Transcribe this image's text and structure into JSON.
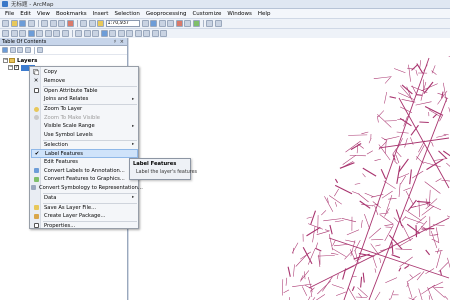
{
  "window": {
    "title": "无标题 - ArcMap"
  },
  "menubar": {
    "items": [
      "File",
      "Edit",
      "View",
      "Bookmarks",
      "Insert",
      "Selection",
      "Geoprocessing",
      "Customize",
      "Windows",
      "Help"
    ]
  },
  "toolbar": {
    "scale_value": "1:70,937"
  },
  "toc": {
    "title": "Table Of Contents",
    "controls": "♯ ×",
    "root_label": "Layers",
    "layer_label": ""
  },
  "context_menu": {
    "items": [
      {
        "label": "Copy",
        "icon": "copy-icon"
      },
      {
        "label": "Remove",
        "icon": "remove-icon"
      },
      {
        "label": "Open Attribute Table",
        "icon": "table-icon"
      },
      {
        "label": "Joins and Relates",
        "submenu": true
      },
      {
        "label": "Zoom To Layer",
        "icon": "zoom-layer-icon"
      },
      {
        "label": "Zoom To Make Visible",
        "disabled": true
      },
      {
        "label": "Visible Scale Range",
        "submenu": true
      },
      {
        "label": "Use Symbol Levels"
      },
      {
        "label": "Selection",
        "submenu": true
      },
      {
        "label": "Label Features",
        "checked": true,
        "highlighted": true
      },
      {
        "label": "Edit Features",
        "submenu": true
      },
      {
        "label": "Convert Labels to Annotation...",
        "icon": "convert-labels-icon"
      },
      {
        "label": "Convert Features to Graphics...",
        "icon": "convert-features-icon"
      },
      {
        "label": "Convert Symbology to Representation...",
        "icon": "convert-symbology-icon"
      },
      {
        "label": "Data",
        "submenu": true
      },
      {
        "label": "Save As Layer File...",
        "icon": "layer-file-icon"
      },
      {
        "label": "Create Layer Package...",
        "icon": "layer-package-icon"
      },
      {
        "label": "Properties...",
        "icon": "properties-icon"
      }
    ]
  },
  "tooltip": {
    "title": "Label Features",
    "body": "Label the layer's features"
  },
  "colors": {
    "road": "#a8336e",
    "highlight": "#cfe3fa",
    "selection": "#3d7ccf"
  }
}
